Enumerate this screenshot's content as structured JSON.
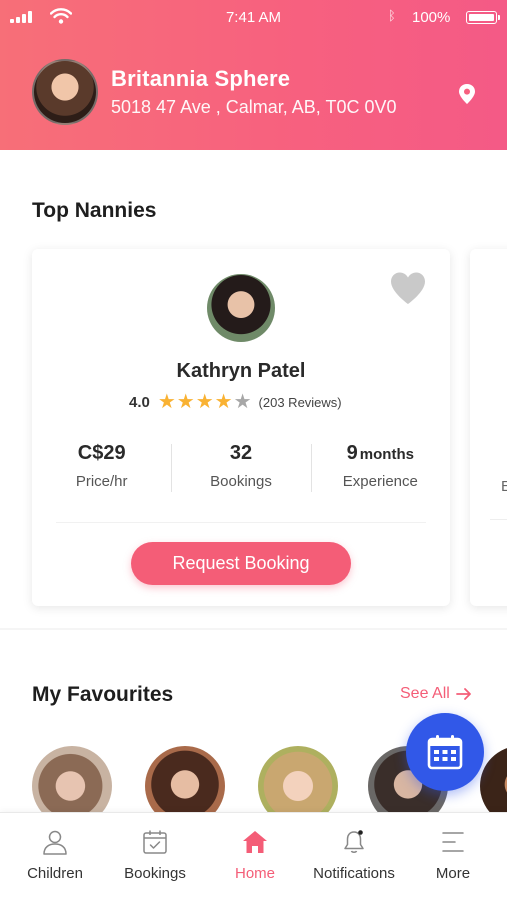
{
  "status_bar": {
    "time": "7:41 AM",
    "battery": "100%"
  },
  "header": {
    "user_name": "Britannia Sphere",
    "address": "5018 47 Ave , Calmar, AB, T0C 0V0",
    "icons": {
      "location": "location-pin-icon"
    }
  },
  "top_nannies": {
    "title": "Top Nannies",
    "card": {
      "name": "Kathryn Patel",
      "rating": "4.0",
      "rating_stars": 4,
      "rating_max": 5,
      "reviews": "(203 Reviews)",
      "stats": [
        {
          "value": "C$29",
          "unit": "",
          "label": "Price/hr"
        },
        {
          "value": "32",
          "unit": "",
          "label": "Bookings"
        },
        {
          "value": "9",
          "unit": "months",
          "label": "Experience"
        }
      ],
      "button": "Request Booking",
      "favourite_icon": "heart-icon"
    },
    "peek_card": {
      "label_fragment": "E"
    }
  },
  "favourites": {
    "title": "My Favourites",
    "see_all": "See All"
  },
  "bottom_nav": {
    "items": [
      {
        "label": "Children",
        "icon": "person-icon",
        "active": false
      },
      {
        "label": "Bookings",
        "icon": "calendar-check-icon",
        "active": false
      },
      {
        "label": "Home",
        "icon": "home-icon",
        "active": true
      },
      {
        "label": "Notifications",
        "icon": "bell-icon",
        "active": false
      },
      {
        "label": "More",
        "icon": "menu-icon",
        "active": false
      }
    ]
  },
  "colors": {
    "header_gradient_start": "#f76f78",
    "header_gradient_end": "#f45a86",
    "accent": "#f45d77",
    "star": "#f9b233",
    "fab": "#3158e8"
  }
}
